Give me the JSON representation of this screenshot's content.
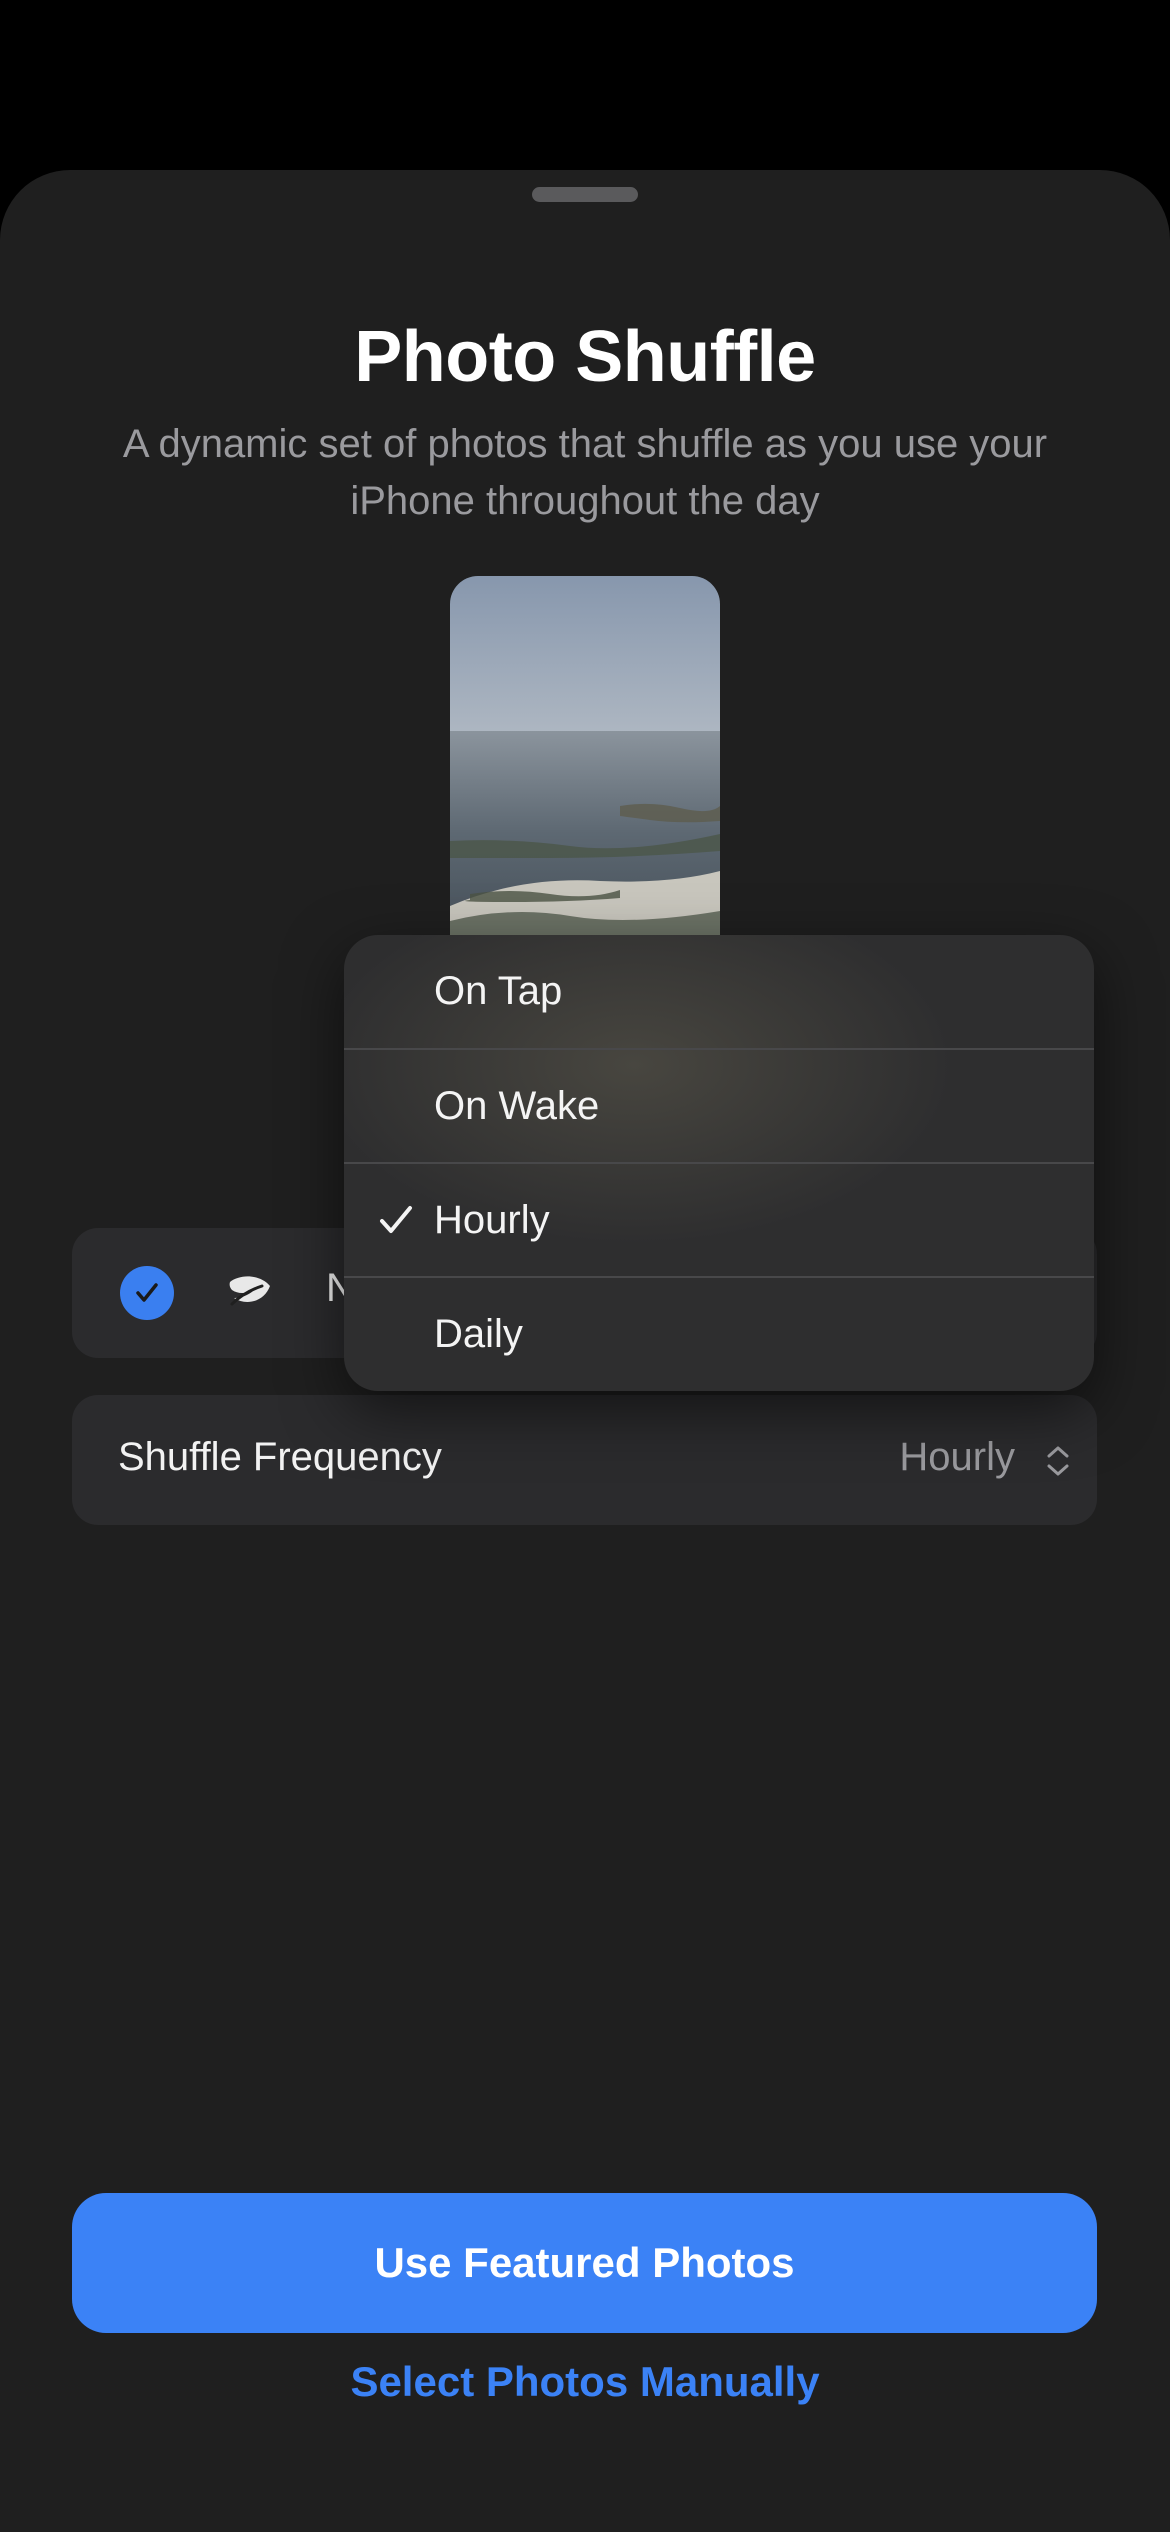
{
  "header": {
    "title": "Photo Shuffle",
    "subtitle_line1": "A dynamic set of photos that shuffle as you use your",
    "subtitle_line2": "iPhone throughout the day"
  },
  "preview": {
    "image": "sea-shore-photo"
  },
  "featured_row": {
    "checked": true,
    "icon": "leaf-icon",
    "label_visible": "N"
  },
  "frequency_row": {
    "label": "Shuffle Frequency",
    "value": "Hourly",
    "icon": "chevron-up-down-icon"
  },
  "frequency_menu": {
    "items": [
      {
        "label": "On Tap",
        "selected": false
      },
      {
        "label": "On Wake",
        "selected": false
      },
      {
        "label": "Hourly",
        "selected": true
      },
      {
        "label": "Daily",
        "selected": false
      }
    ]
  },
  "actions": {
    "primary_label": "Use Featured Photos",
    "secondary_label": "Select Photos Manually"
  },
  "colors": {
    "accent": "#3b82f6",
    "sheet_background": "#1f1f1f",
    "card_background": "#2b2b2d",
    "menu_background": "#2e2e2f"
  }
}
